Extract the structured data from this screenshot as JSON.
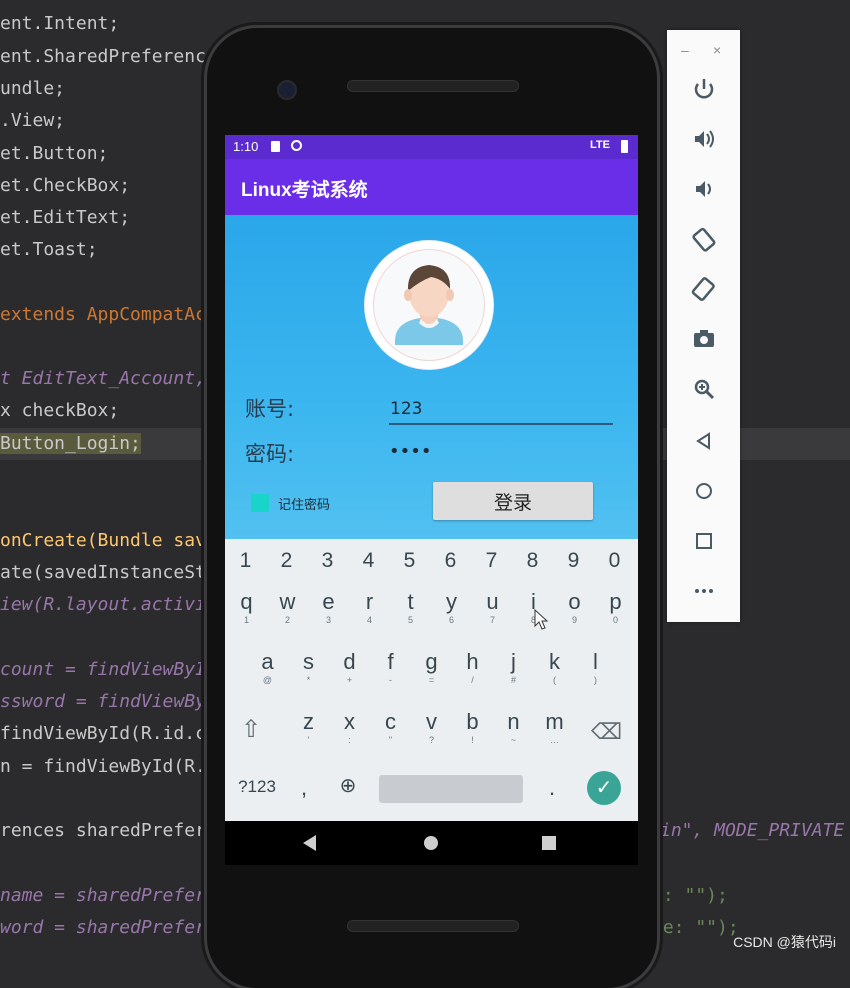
{
  "code_lines": [
    "ent.Intent;",
    "ent.SharedPreferenc",
    "undle;",
    ".View;",
    "et.Button;",
    "et.CheckBox;",
    "et.EditText;",
    "et.Toast;",
    "",
    "extends AppCompatAc",
    "",
    "t EditText_Account,",
    "x checkBox;",
    "Button_Login;",
    "",
    "",
    "onCreate(Bundle sav",
    "ate(savedInstanceSt",
    "iew(R.layout.activi",
    "",
    "count = findViewByI",
    "ssword = findViewBy",
    "findViewById(R.id.c",
    "n = findViewById(R.",
    "",
    "rences sharedPrefer",
    "",
    "name = sharedPrefer",
    "word = sharedPrefer"
  ],
  "code_right": {
    "line_pref": "in\", MODE_PRIVATE",
    "line_name": "e: \"\");",
    "line_word": "ue: \"\");"
  },
  "phone": {
    "status": {
      "time": "1:10",
      "network": "LTE"
    },
    "app_title": "Linux考试系统",
    "form": {
      "account_label": "账号:",
      "account_value": "123",
      "password_label": "密码:",
      "password_value": "••••",
      "remember_label": "记住密码",
      "remember_checked": true,
      "login_label": "登录"
    },
    "keyboard": {
      "numbers": [
        "1",
        "2",
        "3",
        "4",
        "5",
        "6",
        "7",
        "8",
        "9",
        "0"
      ],
      "row1": [
        {
          "k": "q",
          "s": "1"
        },
        {
          "k": "w",
          "s": "2"
        },
        {
          "k": "e",
          "s": "3"
        },
        {
          "k": "r",
          "s": "4"
        },
        {
          "k": "t",
          "s": "5"
        },
        {
          "k": "y",
          "s": "6"
        },
        {
          "k": "u",
          "s": "7"
        },
        {
          "k": "i",
          "s": "8"
        },
        {
          "k": "o",
          "s": "9"
        },
        {
          "k": "p",
          "s": "0"
        }
      ],
      "row2": [
        {
          "k": "a",
          "s": "@"
        },
        {
          "k": "s",
          "s": "*"
        },
        {
          "k": "d",
          "s": "+"
        },
        {
          "k": "f",
          "s": "-"
        },
        {
          "k": "g",
          "s": "="
        },
        {
          "k": "h",
          "s": "/"
        },
        {
          "k": "j",
          "s": "#"
        },
        {
          "k": "k",
          "s": "("
        },
        {
          "k": "l",
          "s": ")"
        }
      ],
      "row3": [
        {
          "k": "z",
          "s": "'"
        },
        {
          "k": "x",
          "s": ":"
        },
        {
          "k": "c",
          "s": "\""
        },
        {
          "k": "v",
          "s": "?"
        },
        {
          "k": "b",
          "s": "!"
        },
        {
          "k": "n",
          "s": "~"
        },
        {
          "k": "m",
          "s": "…"
        }
      ],
      "symbols_label": "?123",
      "comma": ",",
      "period": "."
    }
  },
  "emulator_panel": {
    "minimize": "–",
    "close": "×",
    "buttons": [
      "power-icon",
      "volume-up-icon",
      "volume-down-icon",
      "rotate-left-icon",
      "rotate-right-icon",
      "camera-icon",
      "zoom-icon",
      "back-icon",
      "home-icon",
      "overview-icon",
      "more-icon"
    ]
  },
  "watermark": "CSDN @猿代码i",
  "colors": {
    "app_bar": "#6a2ee8",
    "content_bg": "#2aa7ea",
    "checkbox": "#19d4c9",
    "enter_key": "#3aa596"
  }
}
